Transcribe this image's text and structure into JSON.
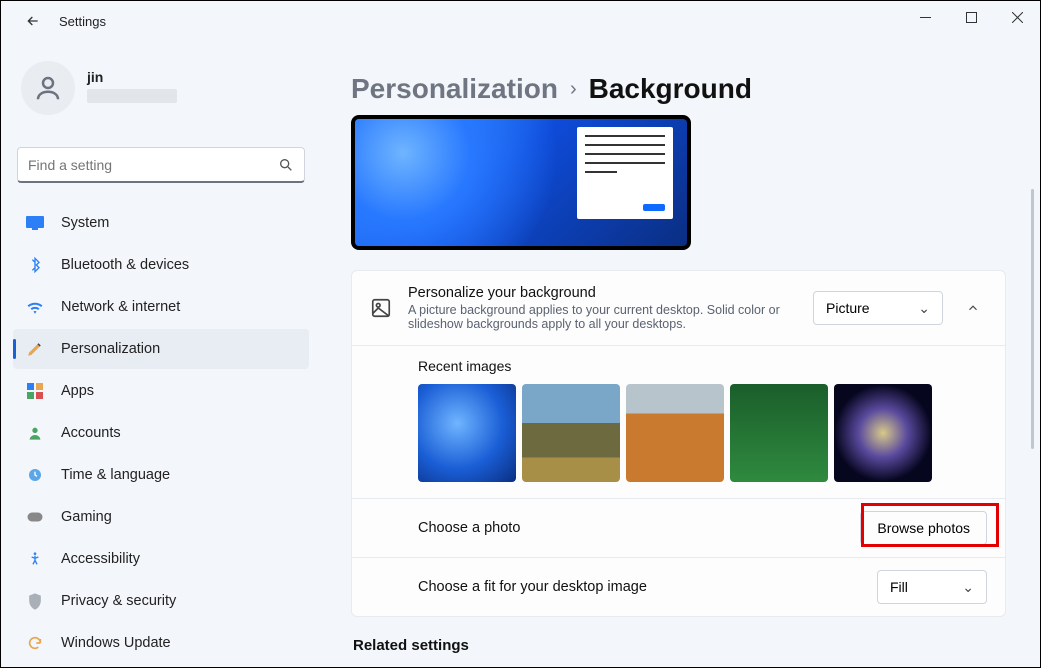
{
  "app_title": "Settings",
  "user": {
    "name": "jin"
  },
  "search": {
    "placeholder": "Find a setting"
  },
  "nav": {
    "items": [
      {
        "id": "system",
        "label": "System"
      },
      {
        "id": "bluetooth",
        "label": "Bluetooth & devices"
      },
      {
        "id": "network",
        "label": "Network & internet"
      },
      {
        "id": "personalization",
        "label": "Personalization",
        "active": true
      },
      {
        "id": "apps",
        "label": "Apps"
      },
      {
        "id": "accounts",
        "label": "Accounts"
      },
      {
        "id": "time",
        "label": "Time & language"
      },
      {
        "id": "gaming",
        "label": "Gaming"
      },
      {
        "id": "accessibility",
        "label": "Accessibility"
      },
      {
        "id": "privacy",
        "label": "Privacy & security"
      },
      {
        "id": "update",
        "label": "Windows Update"
      }
    ]
  },
  "breadcrumb": {
    "parent": "Personalization",
    "current": "Background"
  },
  "background_card": {
    "title": "Personalize your background",
    "subtitle": "A picture background applies to your current desktop. Solid color or slideshow backgrounds apply to all your desktops.",
    "select_value": "Picture"
  },
  "recent": {
    "title": "Recent images"
  },
  "choose_photo": {
    "label": "Choose a photo",
    "button": "Browse photos"
  },
  "choose_fit": {
    "label": "Choose a fit for your desktop image",
    "value": "Fill"
  },
  "related_title": "Related settings"
}
